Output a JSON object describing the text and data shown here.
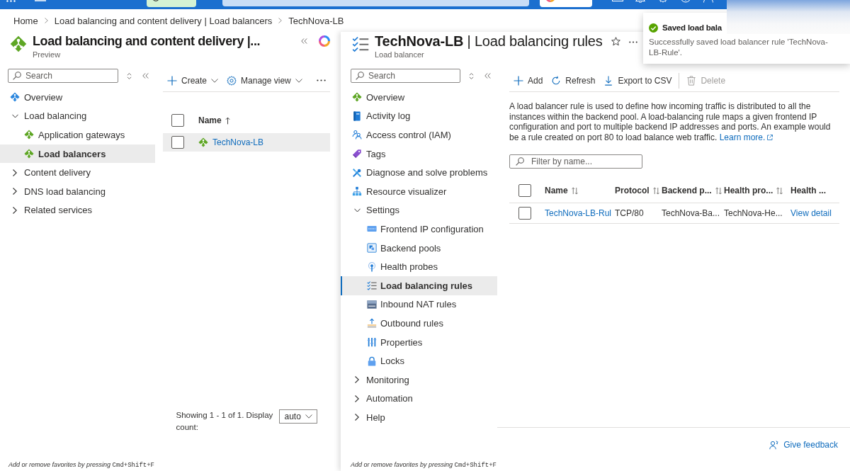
{
  "breadcrumb": [
    "Home",
    "Load balancing and content delivery | Load balancers",
    "TechNova-LB"
  ],
  "left_blade": {
    "title": "Load balancing and content delivery |...",
    "subtitle": "Preview",
    "search": {
      "placeholder": "Search"
    },
    "nav": [
      {
        "kind": "item",
        "label": "Overview",
        "selected": false
      },
      {
        "kind": "group",
        "label": "Load balancing",
        "selected": false,
        "expanded": true,
        "children": [
          {
            "kind": "item",
            "label": "Application gateways",
            "selected": false
          },
          {
            "kind": "item",
            "label": "Load balancers",
            "selected": true
          }
        ]
      },
      {
        "kind": "group",
        "label": "Content delivery",
        "selected": false,
        "expanded": false
      },
      {
        "kind": "group",
        "label": "DNS load balancing",
        "selected": false,
        "expanded": false
      },
      {
        "kind": "group",
        "label": "Related services",
        "selected": false,
        "expanded": false
      }
    ],
    "toolbar": [
      {
        "label": "Create"
      },
      {
        "label": "Manage view"
      }
    ],
    "table": {
      "select_all": {
        "checked": false
      },
      "columns": [
        {
          "label": "Name",
          "sortable": true,
          "sorted": true
        }
      ],
      "rows": [
        {
          "name": "TechNova-LB",
          "checked": false,
          "highlighted": true
        }
      ]
    },
    "pager": {
      "summary": "Showing 1 - 1 of 1. Display count:",
      "page_size": "auto"
    },
    "favorites_hint": {
      "text": "Add or remove favorites by pressing",
      "shortcut": "Cmd+Shift+F"
    }
  },
  "rules_blade": {
    "title": "**TechNova-LB** | Load balancing rules",
    "subtitle": "Load balancer",
    "search": {
      "placeholder": "Search"
    },
    "nav": [
      {
        "kind": "item",
        "label": "Overview",
        "selected": false
      },
      {
        "kind": "item",
        "label": "Activity log",
        "selected": false
      },
      {
        "kind": "item",
        "label": "Access control (IAM)",
        "selected": false
      },
      {
        "kind": "item",
        "label": "Tags",
        "selected": false
      },
      {
        "kind": "item",
        "label": "Diagnose and solve problems",
        "selected": false
      },
      {
        "kind": "item",
        "label": "Resource visualizer",
        "selected": false
      },
      {
        "kind": "group",
        "label": "Settings",
        "selected": false,
        "expanded": true,
        "children": [
          {
            "kind": "item",
            "label": "Frontend IP configuration",
            "selected": false
          },
          {
            "kind": "item",
            "label": "Backend pools",
            "selected": false
          },
          {
            "kind": "item",
            "label": "Health probes",
            "selected": false
          },
          {
            "kind": "item",
            "label": "Load balancing rules",
            "selected": true
          },
          {
            "kind": "item",
            "label": "Inbound NAT rules",
            "selected": false
          },
          {
            "kind": "item",
            "label": "Outbound rules",
            "selected": false
          },
          {
            "kind": "item",
            "label": "Properties",
            "selected": false
          },
          {
            "kind": "item",
            "label": "Locks",
            "selected": false
          }
        ]
      },
      {
        "kind": "group",
        "label": "Monitoring",
        "selected": false,
        "expanded": false
      },
      {
        "kind": "group",
        "label": "Automation",
        "selected": false,
        "expanded": false
      },
      {
        "kind": "group",
        "label": "Help",
        "selected": false,
        "expanded": false
      }
    ],
    "toolbar": [
      {
        "label": "Add",
        "disabled": false
      },
      {
        "label": "Refresh",
        "disabled": false
      },
      {
        "label": "Export to CSV",
        "disabled": false
      },
      {
        "label": "Delete",
        "disabled": true
      }
    ],
    "description": "A load balancer rule is used to define how incoming traffic is distributed to all the instances within the backend pool. A load-balancing rule maps a given frontend IP configuration and port to multiple backend IP addresses and ports. An example would be a rule created on port 80 to load balance web traffic.",
    "learn_more": "Learn more.",
    "filter": {
      "placeholder": "Filter by name..."
    },
    "table": {
      "select_all": {
        "checked": false
      },
      "columns": [
        {
          "label": "Name",
          "sortable": true
        },
        {
          "label": "Protocol",
          "sortable": true
        },
        {
          "label": "Backend p...",
          "sortable": true
        },
        {
          "label": "Health pro...",
          "sortable": true
        },
        {
          "label": "Health ..."
        }
      ],
      "rows": [
        {
          "checked": false,
          "cells": [
            {
              "kind": "link",
              "text": "TechNova-LB-Rul"
            },
            {
              "kind": "text",
              "text": "TCP/80"
            },
            {
              "kind": "text",
              "text": "TechNova-Ba..."
            },
            {
              "kind": "text",
              "text": "TechNova-He..."
            },
            {
              "kind": "link",
              "text": "View detail"
            }
          ]
        }
      ]
    },
    "give_feedback": "Give feedback",
    "favorites_hint": {
      "text": "Add or remove favorites by pressing",
      "shortcut": "Cmd+Shift+F"
    }
  },
  "toast": {
    "title": "Saved load bala",
    "message": "Successfully saved load balancer rule 'TechNova-LB-Rule'."
  }
}
